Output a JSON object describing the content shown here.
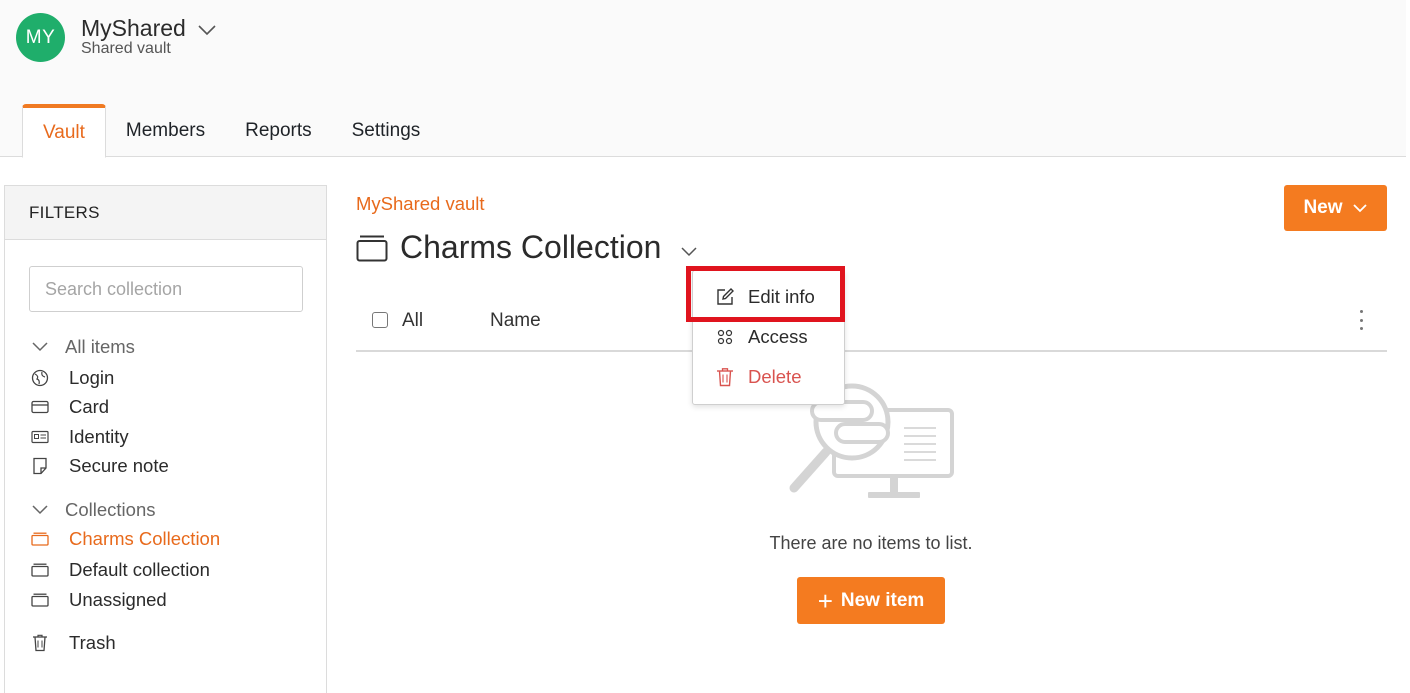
{
  "header": {
    "avatar_initials": "MY",
    "org_name": "MyShared",
    "org_subtitle": "Shared vault",
    "tabs": [
      {
        "label": "Vault",
        "active": true
      },
      {
        "label": "Members",
        "active": false
      },
      {
        "label": "Reports",
        "active": false
      },
      {
        "label": "Settings",
        "active": false
      }
    ]
  },
  "sidebar": {
    "title": "FILTERS",
    "search_placeholder": "Search collection",
    "all_items_label": "All items",
    "types": [
      {
        "label": "Login",
        "icon": "globe-icon"
      },
      {
        "label": "Card",
        "icon": "credit-card-icon"
      },
      {
        "label": "Identity",
        "icon": "id-card-icon"
      },
      {
        "label": "Secure note",
        "icon": "note-icon"
      }
    ],
    "collections_label": "Collections",
    "collections": [
      {
        "label": "Charms Collection",
        "active": true
      },
      {
        "label": "Default collection",
        "active": false
      },
      {
        "label": "Unassigned",
        "active": false
      }
    ],
    "trash_label": "Trash"
  },
  "main": {
    "breadcrumb": "MyShared vault",
    "title": "Charms Collection",
    "new_button": "New",
    "list_header": {
      "all_label": "All",
      "name_label": "Name"
    },
    "empty_text": "There are no items to list.",
    "new_item_button": "New item"
  },
  "menu": {
    "items": [
      {
        "label": "Edit info",
        "icon": "edit-icon"
      },
      {
        "label": "Access",
        "icon": "users-icon"
      },
      {
        "label": "Delete",
        "icon": "trash-icon"
      }
    ]
  },
  "colors": {
    "accent": "#f47b20",
    "avatar": "#1fae6b",
    "highlight": "#e0141e",
    "danger": "#d9534f"
  }
}
